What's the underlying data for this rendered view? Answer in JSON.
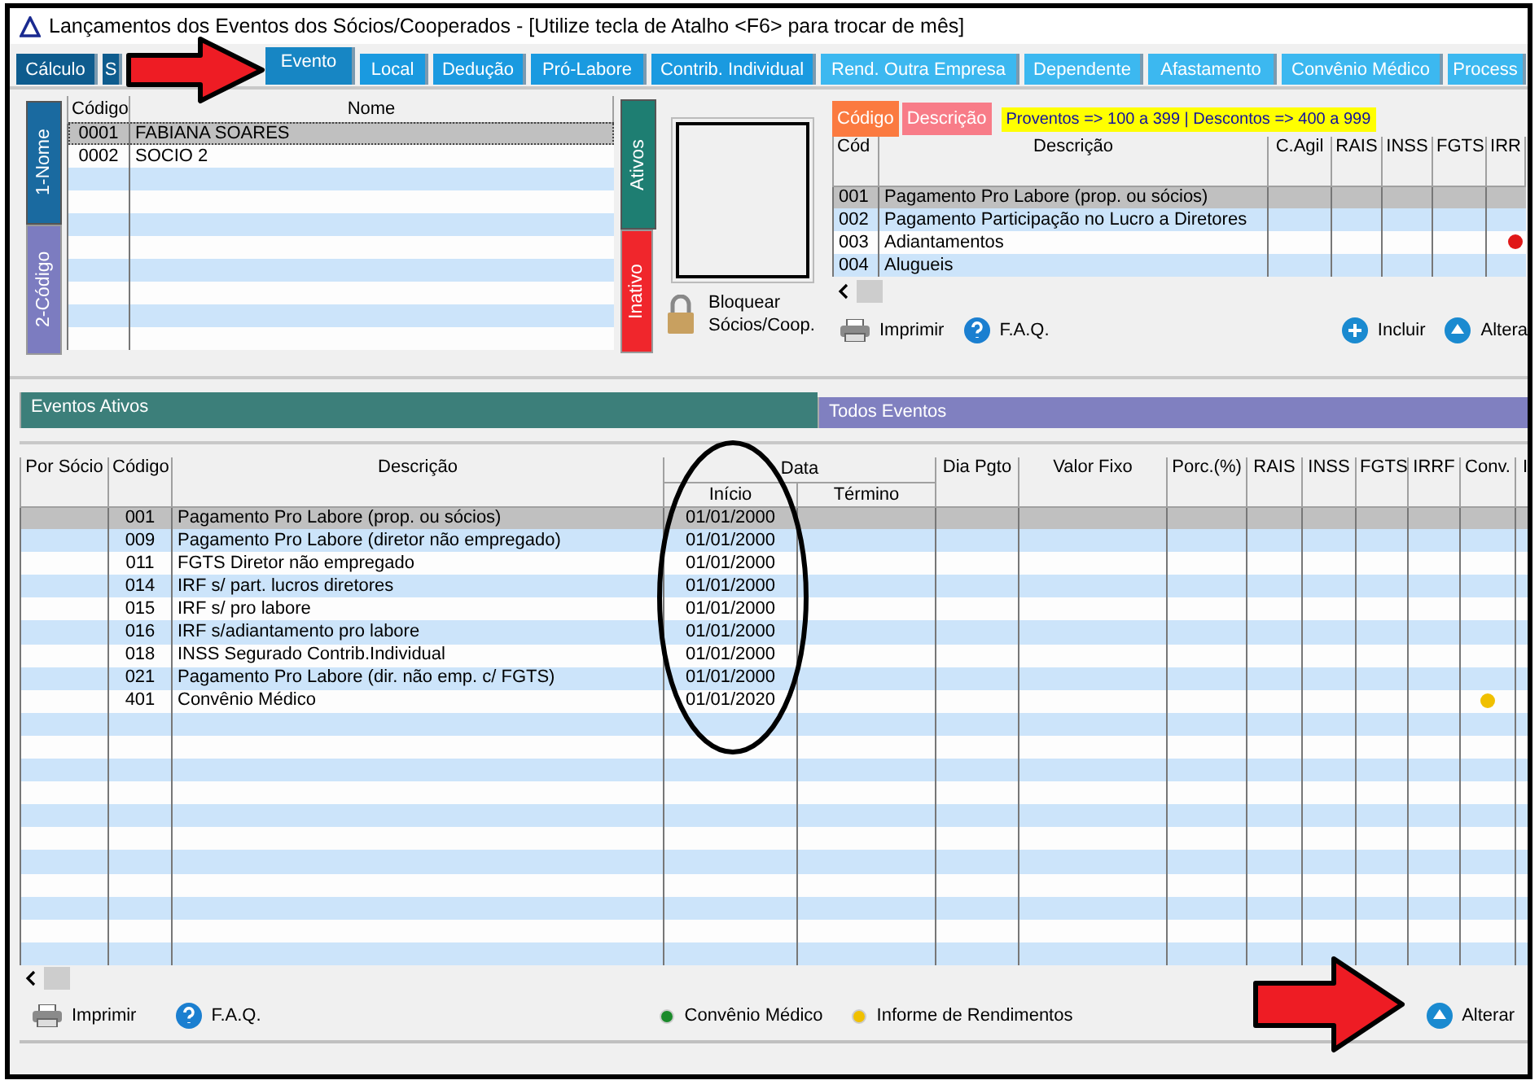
{
  "window": {
    "title": "Lançamentos dos Eventos dos Sócios/Cooperados - [Utilize tecla de Atalho <F6> para trocar de mês]"
  },
  "tabs": [
    {
      "label": "Cálculo",
      "selected": false
    },
    {
      "label": "S",
      "selected": false
    },
    {
      "label": "Evento",
      "selected": true
    },
    {
      "label": "Local",
      "selected": false
    },
    {
      "label": "Dedução",
      "selected": false
    },
    {
      "label": "Pró-Labore",
      "selected": false
    },
    {
      "label": "Contrib. Individual",
      "selected": false
    },
    {
      "label": "Rend. Outra Empresa",
      "selected": false
    },
    {
      "label": "Dependente",
      "selected": false
    },
    {
      "label": "Afastamento",
      "selected": false
    },
    {
      "label": "Convênio Médico",
      "selected": false
    },
    {
      "label": "Process",
      "selected": false
    }
  ],
  "socios": {
    "side_tabs": [
      {
        "label": "1-Nome",
        "selected": true
      },
      {
        "label": "2-Código",
        "selected": false
      }
    ],
    "columns": [
      "Código",
      "Nome"
    ],
    "rows": [
      {
        "codigo": "0001",
        "nome": "FABIANA SOARES",
        "selected": true
      },
      {
        "codigo": "0002",
        "nome": "SOCIO 2",
        "selected": false
      }
    ],
    "status_tabs": [
      {
        "label": "Ativos",
        "selected": true,
        "color": "#1e7e72"
      },
      {
        "label": "Inativo",
        "selected": false,
        "color": "#f0262c"
      }
    ],
    "lock_label": "Bloquear Sócios/Coop."
  },
  "lookup": {
    "sort_tabs": [
      {
        "label": "Código",
        "selected": true
      },
      {
        "label": "Descrição",
        "selected": false
      }
    ],
    "legend": "Proventos => 100 a 399 | Descontos => 400 a 999",
    "columns": [
      "Cód",
      "Descrição",
      "C.Agil",
      "RAIS",
      "INSS",
      "FGTS",
      "IRR"
    ],
    "rows": [
      {
        "cod": "001",
        "descricao": "Pagamento Pro Labore (prop. ou sócios)",
        "selected": true
      },
      {
        "cod": "002",
        "descricao": "Pagamento Participação no Lucro a Diretores",
        "selected": false
      },
      {
        "cod": "003",
        "descricao": "Adiantamentos",
        "selected": false,
        "irr_dot": {
          "color": "#e01818"
        }
      },
      {
        "cod": "004",
        "descricao": "Alugueis",
        "selected": false
      }
    ],
    "actions": [
      {
        "kind": "print",
        "label": "Imprimir"
      },
      {
        "kind": "help",
        "label": "F.A.Q."
      },
      {
        "kind": "add",
        "label": "Incluir"
      },
      {
        "kind": "edit",
        "label": "Altera"
      }
    ]
  },
  "section_tabs": [
    {
      "label": "Eventos Ativos",
      "selected": true
    },
    {
      "label": "Todos Eventos",
      "selected": false
    }
  ],
  "eventos": {
    "columns": [
      "Por Sócio",
      "Código",
      "Descrição",
      "Data",
      "Início",
      "Término",
      "Dia Pgto",
      "Valor Fixo",
      "Porc.(%)",
      "RAIS",
      "INSS",
      "FGTS",
      "IRRF",
      "Conv.",
      "I"
    ],
    "rows": [
      {
        "codigo": "001",
        "descricao": "Pagamento Pro Labore (prop. ou sócios)",
        "inicio": "01/01/2000",
        "selected": true
      },
      {
        "codigo": "009",
        "descricao": "Pagamento Pro Labore (diretor não empregado)",
        "inicio": "01/01/2000",
        "selected": false
      },
      {
        "codigo": "011",
        "descricao": "FGTS Diretor não empregado",
        "inicio": "01/01/2000",
        "selected": false
      },
      {
        "codigo": "014",
        "descricao": "IRF s/ part. lucros diretores",
        "inicio": "01/01/2000",
        "selected": false
      },
      {
        "codigo": "015",
        "descricao": "IRF s/ pro labore",
        "inicio": "01/01/2000",
        "selected": false
      },
      {
        "codigo": "016",
        "descricao": "IRF s/adiantamento pro labore",
        "inicio": "01/01/2000",
        "selected": false
      },
      {
        "codigo": "018",
        "descricao": "INSS Segurado Contrib.Individual",
        "inicio": "01/01/2000",
        "selected": false
      },
      {
        "codigo": "021",
        "descricao": "Pagamento Pro Labore (dir. não emp. c/ FGTS)",
        "inicio": "01/01/2000",
        "selected": false
      },
      {
        "codigo": "401",
        "descricao": "Convênio Médico",
        "inicio": "01/01/2020",
        "selected": false,
        "conv_dot": {
          "color": "#f0c000"
        }
      }
    ],
    "actions": [
      {
        "kind": "print",
        "label": "Imprimir"
      },
      {
        "kind": "help",
        "label": "F.A.Q."
      }
    ],
    "legend": [
      {
        "label": "Convênio Médico",
        "color": "#1a8a2a"
      },
      {
        "label": "Informe de Rendimentos",
        "color": "#f0c000"
      }
    ],
    "edit_action": {
      "kind": "edit",
      "label": "Alterar"
    }
  }
}
